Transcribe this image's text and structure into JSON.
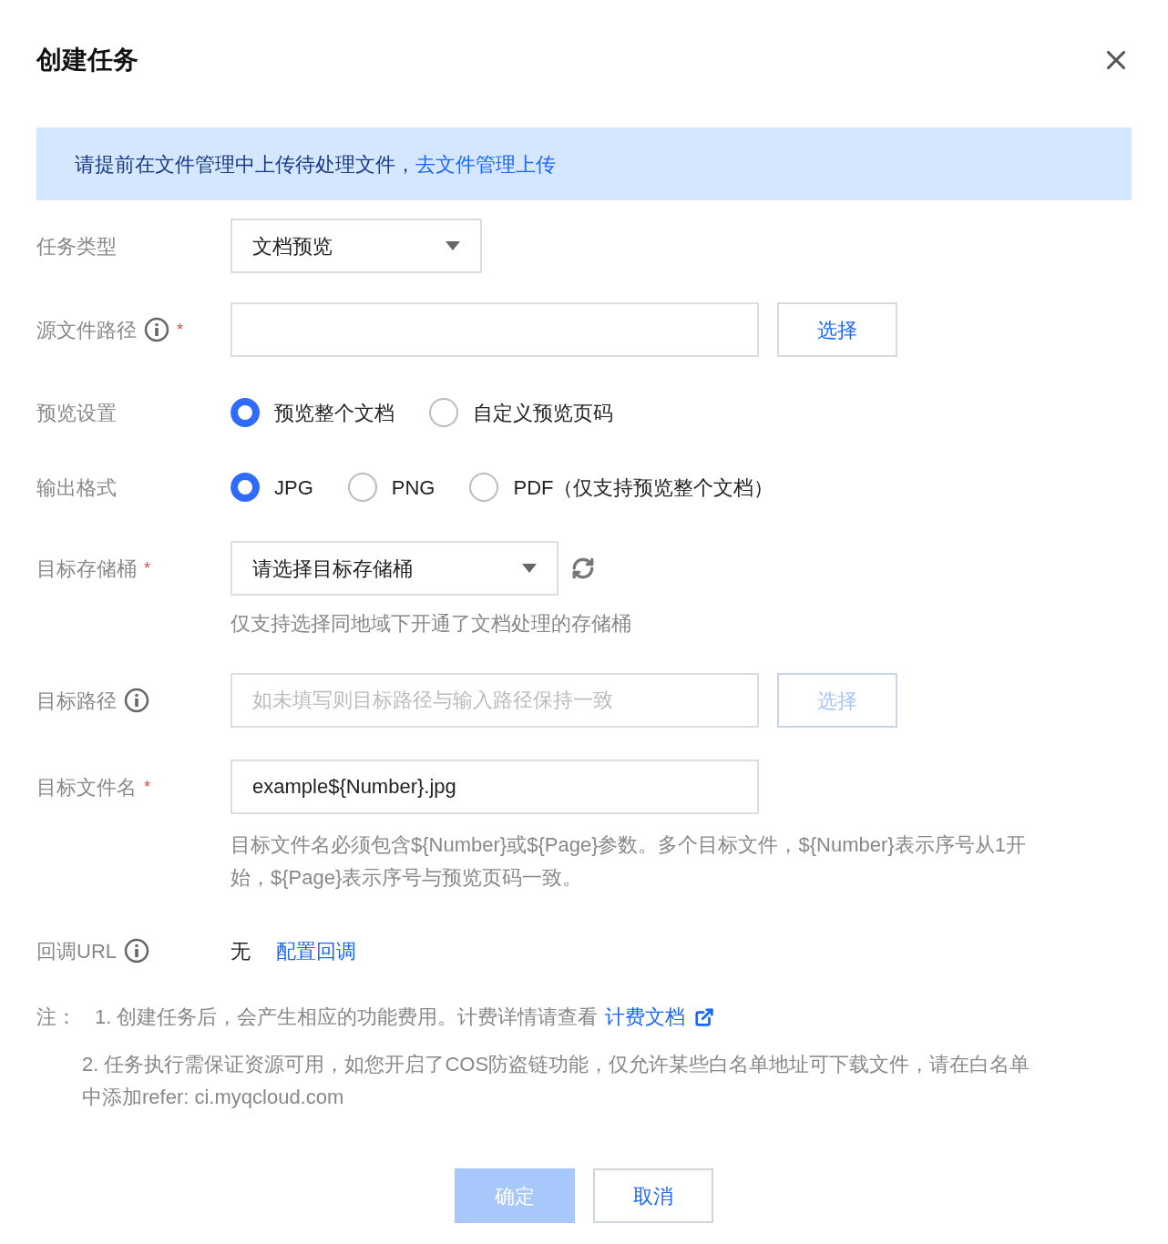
{
  "dialog": {
    "title": "创建任务"
  },
  "notice": {
    "text": "请提前在文件管理中上传待处理文件，",
    "link": "去文件管理上传"
  },
  "form": {
    "task_type": {
      "label": "任务类型",
      "info": false,
      "value": "文档预览"
    },
    "source_path": {
      "label": "源文件路径",
      "required_mark": "*",
      "info": true,
      "button": {
        "label": "选择",
        "disabled": false
      }
    },
    "preview": {
      "label": "预览设置",
      "info": false,
      "options": [
        {
          "label": "预览整个文档",
          "selected": true
        },
        {
          "label": "自定义预览页码",
          "selected": false
        }
      ]
    },
    "output_format": {
      "label": "输出格式",
      "info": false,
      "options": [
        {
          "label": "JPG",
          "selected": true
        },
        {
          "label": "PNG",
          "selected": false
        },
        {
          "label": "PDF（仅支持预览整个文档）",
          "selected": false
        }
      ]
    },
    "target_bucket": {
      "label": "目标存储桶",
      "required_mark": "*",
      "info": false,
      "value": "请选择目标存储桶",
      "hint": "仅支持选择同地域下开通了文档处理的存储桶"
    },
    "target_path": {
      "label": "目标路径",
      "info": true,
      "placeholder": "如未填写则目标路径与输入路径保持一致",
      "button": {
        "label": "选择",
        "disabled": true
      }
    },
    "target_filename": {
      "label": "目标文件名",
      "required_mark": "*",
      "info": false,
      "value": "example${Number}.jpg",
      "hint": "目标文件名必须包含${Number}或${Page}参数。多个目标文件，${Number}表示序号从1开始，${Page}表示序号与预览页码一致。"
    },
    "callback_url": {
      "label": "回调URL",
      "info": true,
      "value": "无",
      "link": "配置回调"
    }
  },
  "notes": {
    "label": "注：",
    "items": [
      {
        "text": "1. 创建任务后，会产生相应的功能费用。计费详情请查看",
        "link": "计费文档"
      },
      {
        "text": "2. 任务执行需保证资源可用，如您开启了COS防盗链功能，仅允许某些白名单地址可下载文件，请在白名单中添加refer: ci.myqcloud.com"
      }
    ]
  },
  "buttons": [
    {
      "label": "确定",
      "primary": true,
      "disabled": true
    },
    {
      "label": "取消",
      "primary": false,
      "disabled": false
    }
  ]
}
